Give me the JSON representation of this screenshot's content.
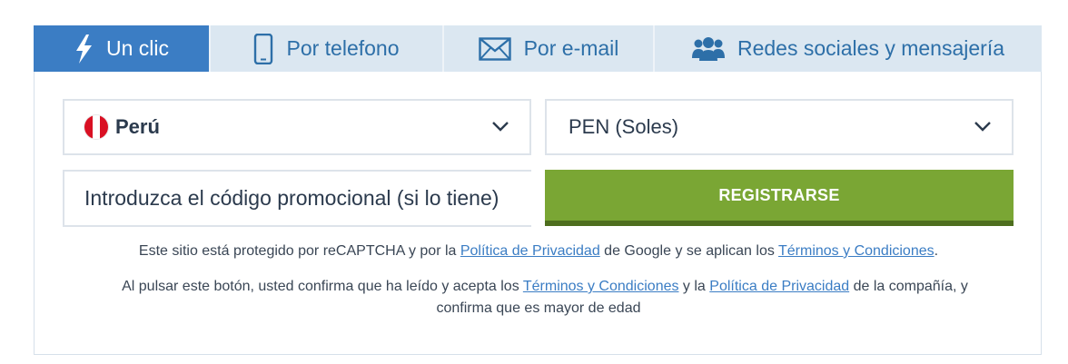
{
  "tabs": [
    {
      "label": "Un clic",
      "icon": "lightning-icon",
      "active": true
    },
    {
      "label": "Por telefono",
      "icon": "phone-icon",
      "active": false
    },
    {
      "label": "Por e-mail",
      "icon": "envelope-icon",
      "active": false
    },
    {
      "label": "Redes sociales y mensajería",
      "icon": "users-icon",
      "active": false
    }
  ],
  "form": {
    "country": {
      "value": "Perú",
      "flag": "peru-flag-icon"
    },
    "currency": {
      "value": "PEN (Soles)"
    },
    "promo": {
      "placeholder": "Introduzca el código promocional (si lo tiene)",
      "value": ""
    },
    "register_label": "REGISTRARSE"
  },
  "recaptcha_note": {
    "pre": "Este sitio está protegido por reCAPTCHA y por la ",
    "privacy_link": "Política de Privacidad",
    "mid": " de Google y se aplican los ",
    "terms_link": "Términos y Condiciones",
    "post": "."
  },
  "consent_note": {
    "pre": "Al pulsar este botón, usted confirma que ha leído y acepta los ",
    "terms_link": "Términos y Condiciones",
    "mid": " y la ",
    "privacy_link": "Política de Privacidad",
    "post_line1": " de la compañía, y",
    "line2": "confirma que es mayor de edad"
  },
  "colors": {
    "active_tab": "#3b7dc4",
    "inactive_tab": "#dbe7f1",
    "tab_text": "#2d6fa8",
    "register": "#7aa634",
    "link": "#3b7dc4"
  }
}
